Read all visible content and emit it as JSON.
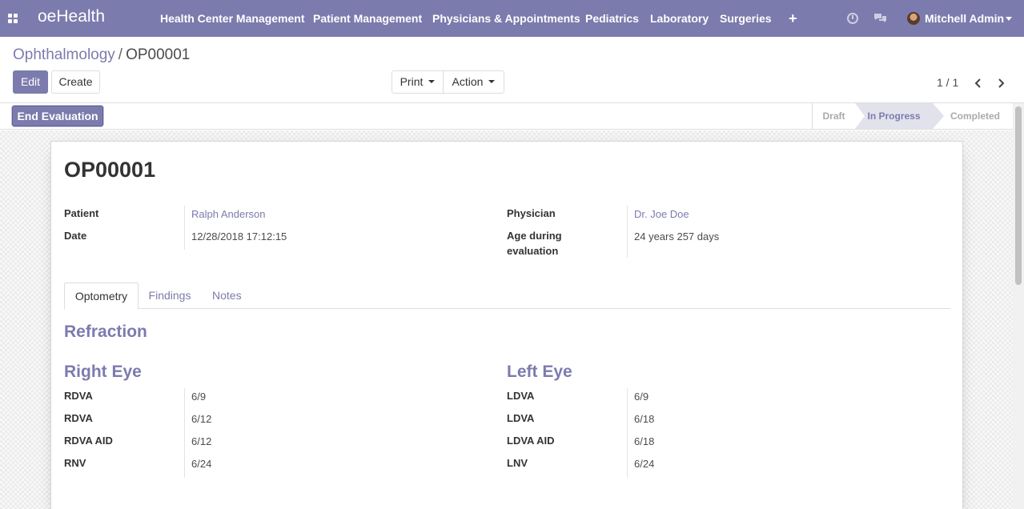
{
  "navbar": {
    "brand": "oeHealth",
    "menu": [
      "Health Center Management",
      "Patient Management",
      "Physicians & Appointments",
      "Pediatrics",
      "Laboratory",
      "Surgeries"
    ],
    "plus_label": "+",
    "user_name": "Mitchell Admin",
    "bg_color": "#7c7bad"
  },
  "breadcrumb": {
    "parent": "Ophthalmology",
    "separator": "/",
    "current": "OP00001"
  },
  "buttons": {
    "edit": "Edit",
    "create": "Create",
    "print": "Print",
    "action": "Action",
    "end_evaluation": "End Evaluation"
  },
  "pager": {
    "value": "1 / 1"
  },
  "statusbar": {
    "stages": [
      "Draft",
      "In Progress",
      "Completed"
    ],
    "active_stage": "In Progress"
  },
  "record": {
    "title": "OP00001",
    "fields": {
      "patient_label": "Patient",
      "patient_value": "Ralph Anderson",
      "date_label": "Date",
      "date_value": "12/28/2018 17:12:15",
      "physician_label": "Physician",
      "physician_value": "Dr. Joe Doe",
      "age_label_line1": "Age during",
      "age_label_line2": "evaluation",
      "age_value": "24 years 257 days"
    }
  },
  "tabs": [
    "Optometry",
    "Findings",
    "Notes"
  ],
  "active_tab": "Optometry",
  "optometry": {
    "section_title": "Refraction",
    "right_eye": {
      "title": "Right Eye",
      "rows": [
        {
          "label": "RDVA",
          "value": "6/9"
        },
        {
          "label": "RDVA",
          "value": "6/12"
        },
        {
          "label": "RDVA AID",
          "value": "6/12"
        },
        {
          "label": "RNV",
          "value": "6/24"
        }
      ]
    },
    "left_eye": {
      "title": "Left Eye",
      "rows": [
        {
          "label": "LDVA",
          "value": "6/9"
        },
        {
          "label": "LDVA",
          "value": "6/18"
        },
        {
          "label": "LDVA AID",
          "value": "6/18"
        },
        {
          "label": "LNV",
          "value": "6/24"
        }
      ]
    }
  }
}
